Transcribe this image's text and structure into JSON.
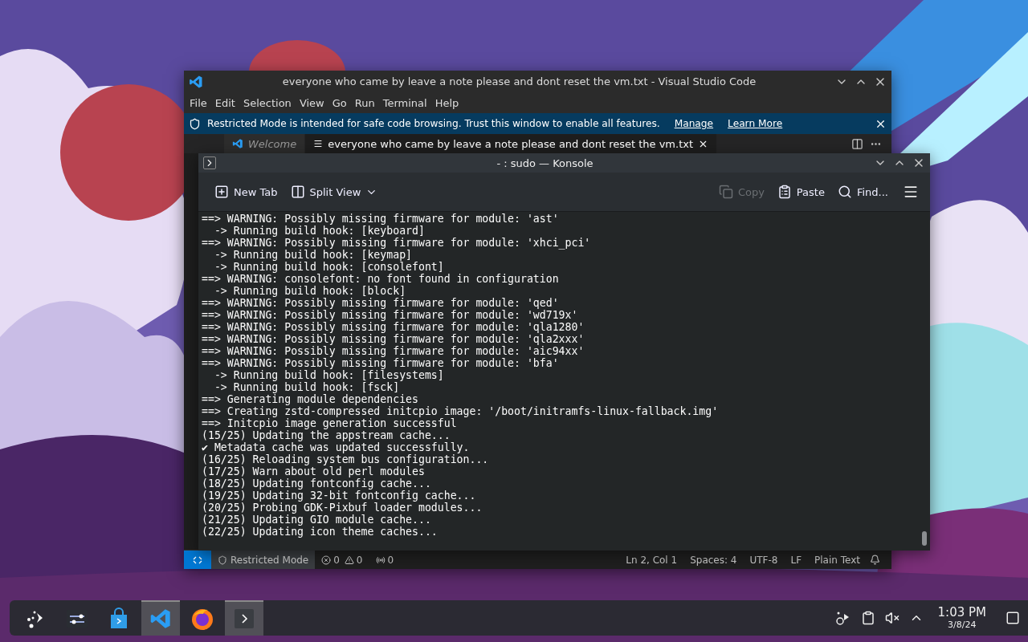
{
  "vscode": {
    "title": "everyone who came by leave a note please and dont reset the vm.txt - Visual Studio Code",
    "menu": [
      "File",
      "Edit",
      "Selection",
      "View",
      "Go",
      "Run",
      "Terminal",
      "Help"
    ],
    "banner": {
      "text": "Restricted Mode is intended for safe code browsing. Trust this window to enable all features.",
      "links": [
        "Manage",
        "Learn More"
      ]
    },
    "tabs": [
      {
        "label": "Welcome",
        "kind": "welcome",
        "selected": false
      },
      {
        "label": "everyone who came by leave a note please and dont reset the vm.txt",
        "kind": "file",
        "selected": true
      }
    ],
    "status_bar": {
      "restricted": "Restricted Mode",
      "errors": "0",
      "warnings": "0",
      "ports": "0",
      "right": [
        "Ln 2, Col 1",
        "Spaces: 4",
        "UTF-8",
        "LF",
        "Plain Text"
      ]
    }
  },
  "konsole": {
    "title": "- : sudo — Konsole",
    "toolbar": [
      {
        "label": "New Tab",
        "kind": "newtab",
        "disabled": false
      },
      {
        "label": "Split View",
        "kind": "split",
        "disabled": false
      },
      {
        "label": "Copy",
        "kind": "copy",
        "disabled": true
      },
      {
        "label": "Paste",
        "kind": "paste",
        "disabled": false
      },
      {
        "label": "Find...",
        "kind": "find",
        "disabled": false
      }
    ],
    "lines": [
      "==> WARNING: Possibly missing firmware for module: 'ast'",
      "  -> Running build hook: [keyboard]",
      "==> WARNING: Possibly missing firmware for module: 'xhci_pci'",
      "  -> Running build hook: [keymap]",
      "  -> Running build hook: [consolefont]",
      "==> WARNING: consolefont: no font found in configuration",
      "  -> Running build hook: [block]",
      "==> WARNING: Possibly missing firmware for module: 'qed'",
      "==> WARNING: Possibly missing firmware for module: 'wd719x'",
      "==> WARNING: Possibly missing firmware for module: 'qla1280'",
      "==> WARNING: Possibly missing firmware for module: 'qla2xxx'",
      "==> WARNING: Possibly missing firmware for module: 'aic94xx'",
      "==> WARNING: Possibly missing firmware for module: 'bfa'",
      "  -> Running build hook: [filesystems]",
      "  -> Running build hook: [fsck]",
      "==> Generating module dependencies",
      "==> Creating zstd-compressed initcpio image: '/boot/initramfs-linux-fallback.img'",
      "==> Initcpio image generation successful",
      "(15/25) Updating the appstream cache...",
      "✔ Metadata cache was updated successfully.",
      "(16/25) Reloading system bus configuration...",
      "(17/25) Warn about old perl modules",
      "(18/25) Updating fontconfig cache...",
      "(19/25) Updating 32-bit fontconfig cache...",
      "(20/25) Probing GDK-Pixbuf loader modules...",
      "(21/25) Updating GIO module cache...",
      "(22/25) Updating icon theme caches..."
    ]
  },
  "taskbar": {
    "apps": [
      {
        "kind": "launcher",
        "open": false
      },
      {
        "kind": "settings",
        "open": false
      },
      {
        "kind": "store",
        "open": false
      },
      {
        "kind": "vscode",
        "open": true
      },
      {
        "kind": "firefox",
        "open": false
      },
      {
        "kind": "terminal",
        "open": true
      }
    ],
    "time": "1:03 PM",
    "date": "3/8/24"
  }
}
